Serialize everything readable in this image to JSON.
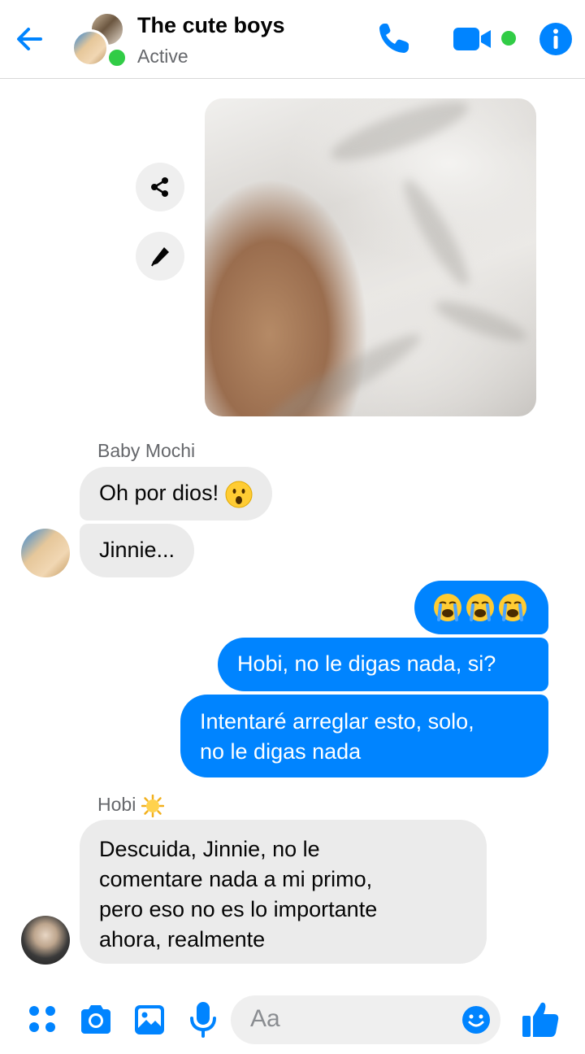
{
  "header": {
    "title": "The cute boys",
    "status": "Active"
  },
  "colors": {
    "accent": "#0084ff",
    "active": "#31cc46",
    "incoming_bubble": "#ebebeb"
  },
  "messages": {
    "baby_mochi_name": "Baby Mochi",
    "msg1": "Oh por dios! ",
    "msg2": "Jinnie...",
    "out1_emojis": "crying-face x3",
    "out2": "Hobi, no le digas nada, si?",
    "out3_line1": "Intentaré arreglar esto, solo,",
    "out3_line2": "no le digas nada",
    "hobi_name": "Hobi ",
    "hobi_line1": "Descuida, Jinnie, no le",
    "hobi_line2": "comentare nada a mi primo,",
    "hobi_line3": "pero eso no es lo importante",
    "hobi_line4": "ahora, realmente"
  },
  "composer": {
    "placeholder": "Aa"
  },
  "icons": [
    "back-arrow-icon",
    "phone-icon",
    "video-camera-icon",
    "info-icon",
    "share-icon",
    "pencil-icon",
    "menu-dots-icon",
    "camera-icon",
    "image-icon",
    "microphone-icon",
    "smiley-icon",
    "thumbs-up-icon"
  ]
}
